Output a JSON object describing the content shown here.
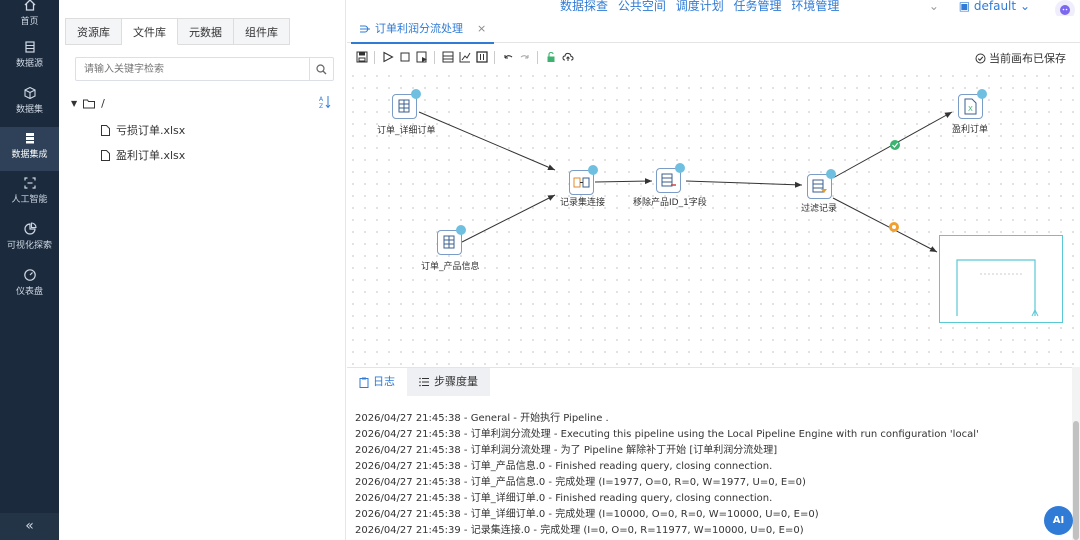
{
  "sidebar": {
    "items": [
      {
        "label": "首页",
        "icon": "home-icon"
      },
      {
        "label": "数据源",
        "icon": "database-icon"
      },
      {
        "label": "数据集",
        "icon": "dataset-cube-icon"
      },
      {
        "label": "数据集成",
        "icon": "integration-icon"
      },
      {
        "label": "人工智能",
        "icon": "ai-scan-icon"
      },
      {
        "label": "可视化探索",
        "icon": "pie-chart-icon"
      },
      {
        "label": "仪表盘",
        "icon": "dashboard-gauge-icon"
      }
    ],
    "active_index": 3,
    "collapse_glyph": "«"
  },
  "topnav": {
    "items": [
      "数据探查",
      "公共空间",
      "调度计划",
      "任务管理",
      "环境管理"
    ],
    "workspace": "default"
  },
  "left_panel": {
    "tabs": [
      "资源库",
      "文件库",
      "元数据",
      "组件库"
    ],
    "active_tab": 1,
    "search_placeholder": "请输入关键字检索",
    "tree_root": "/",
    "files": [
      "亏损订单.xlsx",
      "盈利订单.xlsx"
    ]
  },
  "pipeline_tab": {
    "title": "订单利润分流处理",
    "close": "×"
  },
  "toolbar": {
    "saved_status": "当前画布已保存"
  },
  "canvas": {
    "nodes": [
      {
        "id": "n1",
        "label": "订单_详细订单"
      },
      {
        "id": "n2",
        "label": "订单_产品信息"
      },
      {
        "id": "n3",
        "label": "记录集连接"
      },
      {
        "id": "n4",
        "label": "移除产品ID_1字段"
      },
      {
        "id": "n5",
        "label": "过滤记录"
      },
      {
        "id": "n6",
        "label": "盈利订单"
      }
    ],
    "colors": {
      "accent": "#2f7bd6",
      "ok": "#3cb371",
      "warn": "#f0a030",
      "edge": "#333333"
    }
  },
  "bottom_panel": {
    "tabs": [
      "日志",
      "步骤度量"
    ],
    "active_tab": 0,
    "log_lines": [
      "2026/04/27 21:45:38 - General - 开始执行 Pipeline .",
      "2026/04/27 21:45:38 - 订单利润分流处理 - Executing this pipeline using the Local Pipeline Engine with run configuration 'local'",
      "2026/04/27 21:45:38 - 订单利润分流处理 - 为了 Pipeline 解除补丁开始 [订单利润分流处理]",
      "2026/04/27 21:45:38 - 订单_产品信息.0 - Finished reading query, closing connection.",
      "2026/04/27 21:45:38 - 订单_产品信息.0 - 完成处理 (I=1977, O=0, R=0, W=1977, U=0, E=0)",
      "2026/04/27 21:45:38 - 订单_详细订单.0 - Finished reading query, closing connection.",
      "2026/04/27 21:45:38 - 订单_详细订单.0 - 完成处理 (I=10000, O=0, R=0, W=10000, U=0, E=0)",
      "2026/04/27 21:45:39 - 记录集连接.0 - 完成处理 (I=0, O=0, R=11977, W=10000, U=0, E=0)"
    ]
  },
  "ai_button": "AI"
}
